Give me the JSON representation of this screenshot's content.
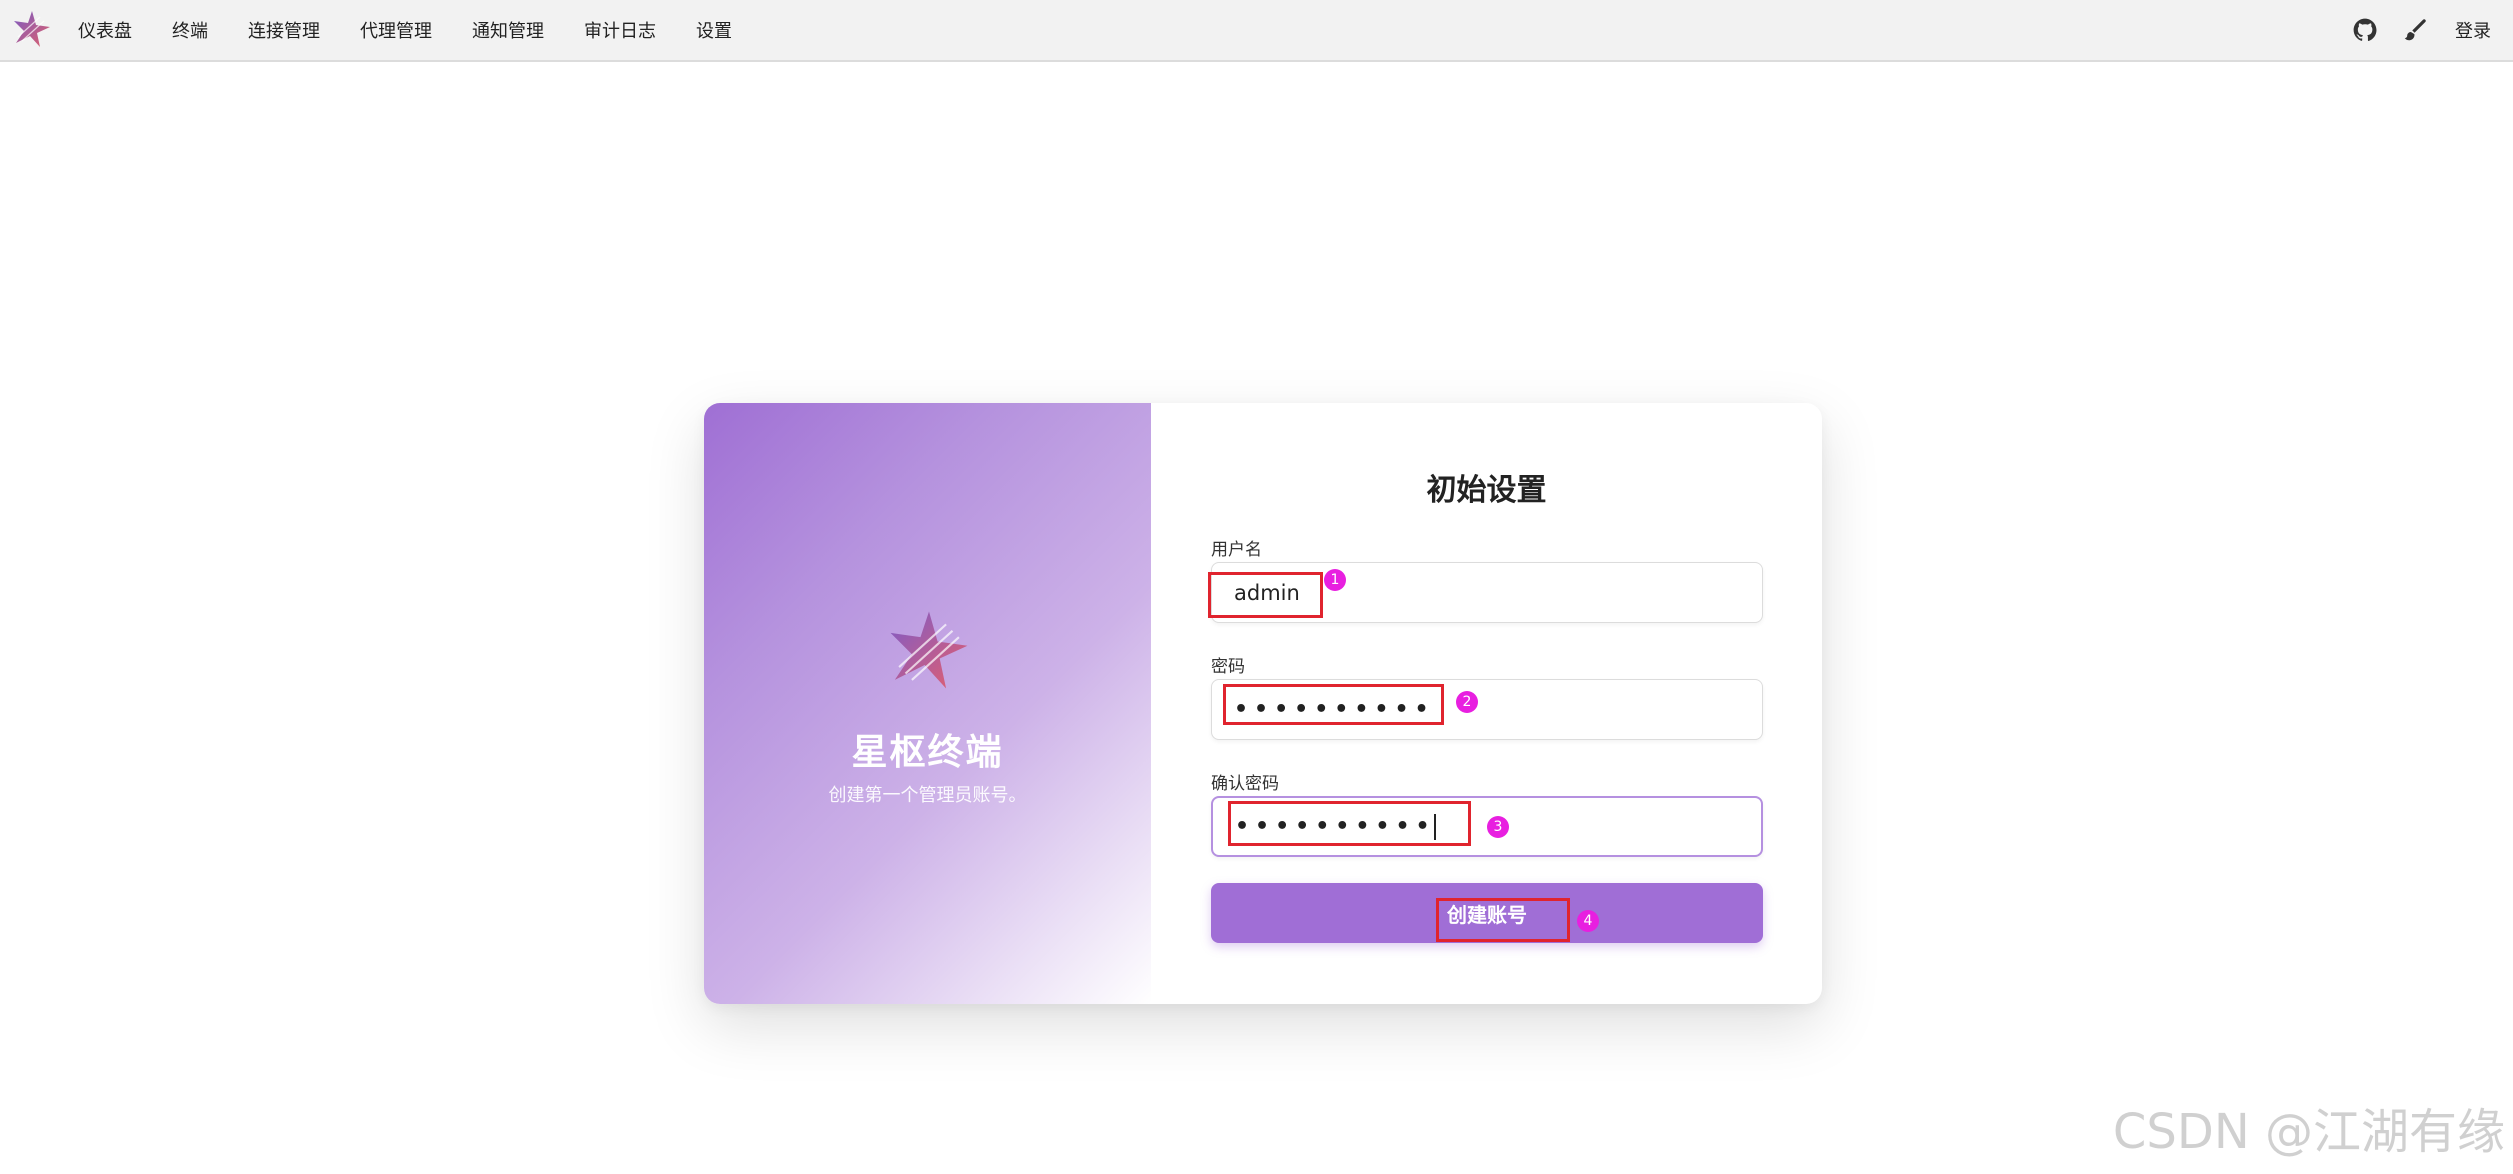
{
  "nav": {
    "items": [
      {
        "label": "仪表盘"
      },
      {
        "label": "终端"
      },
      {
        "label": "连接管理"
      },
      {
        "label": "代理管理"
      },
      {
        "label": "通知管理"
      },
      {
        "label": "审计日志"
      },
      {
        "label": "设置"
      }
    ],
    "right": {
      "icons": [
        "github-icon",
        "brush-icon"
      ],
      "login_label": "登录"
    }
  },
  "brand": {
    "name": "星枢终端",
    "subtitle": "创建第一个管理员账号。",
    "logo_icon": "star-logo-icon",
    "gradient_colors": [
      "#9f6fd4",
      "#cdb2e8",
      "#ffffff"
    ]
  },
  "form": {
    "title": "初始设置",
    "username": {
      "label": "用户名",
      "value": "admin"
    },
    "password": {
      "label": "密码",
      "value_masked": "••••••••••"
    },
    "confirm_password": {
      "label": "确认密码",
      "value_masked": "••••••••••"
    },
    "submit_label": "创建账号"
  },
  "annotations": [
    "1",
    "2",
    "3",
    "4"
  ],
  "colors": {
    "accent": "#a06ed6",
    "annotation_box": "#e0242e",
    "annotation_badge": "#e81fe0"
  },
  "watermark": "CSDN @江湖有缘"
}
